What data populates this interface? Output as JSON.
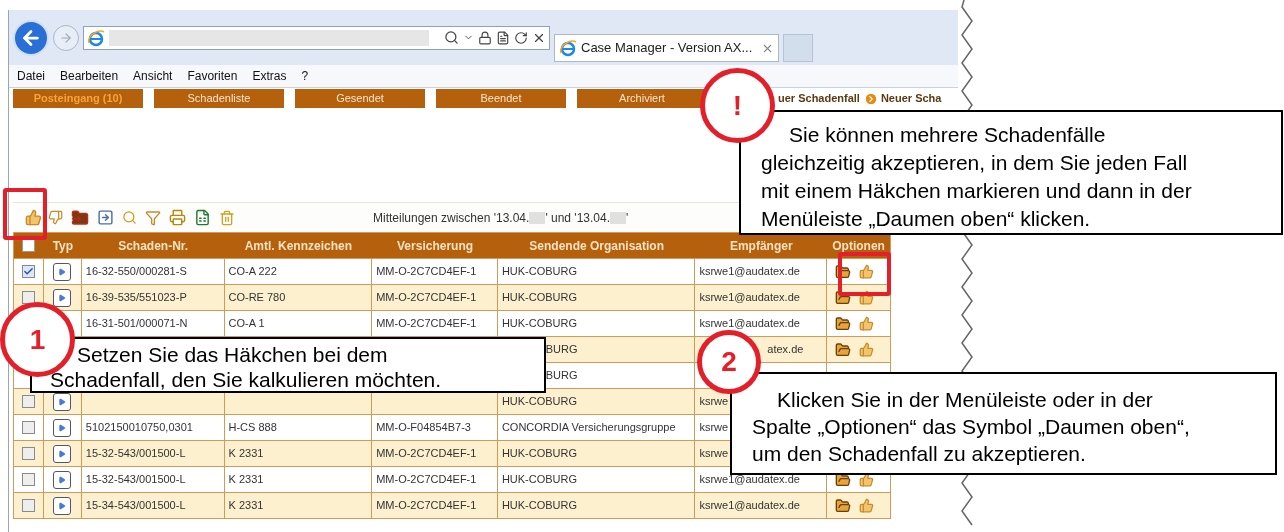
{
  "browser": {
    "tab_title": "Case Manager - Version AX...",
    "menu": [
      "Datei",
      "Bearbeiten",
      "Ansicht",
      "Favoriten",
      "Extras",
      "?"
    ]
  },
  "nav": {
    "tabs": [
      {
        "label": "Posteingang (10)",
        "selected": true
      },
      {
        "label": "Schadenliste",
        "selected": false
      },
      {
        "label": "Gesendet",
        "selected": false
      },
      {
        "label": "Beendet",
        "selected": false
      },
      {
        "label": "Archiviert",
        "selected": false
      }
    ],
    "links": [
      "uer Schadenfall",
      "Neuer Scha"
    ]
  },
  "toolbar": {
    "date_range": [
      "Mitteilungen zwischen '13.04.",
      "' und '13.04.",
      "'"
    ]
  },
  "table": {
    "select_all": {
      "checked": false
    },
    "header_labels": [
      "Typ",
      "Schaden-Nr.",
      "Amtl. Kennzeichen",
      "Versicherung",
      "Sendende Organisation",
      "Empfänger",
      "Optionen"
    ],
    "rows": [
      {
        "kind": "full",
        "checked": true,
        "cells": [
          "16-32-550/000281-S",
          "CO-A 222",
          "MM-O-2C7CD4EF-1",
          "HUK-COBURG",
          "ksrwe1@audatex.de"
        ]
      },
      {
        "kind": "full",
        "checked": false,
        "cells": [
          "16-39-535/551023-P",
          "CO-RE 780",
          "MM-O-2C7CD4EF-1",
          "HUK-COBURG",
          "ksrwe1@audatex.de"
        ]
      },
      {
        "kind": "partial",
        "cells": [
          "16-31-501/000071-N",
          "CO-A 1",
          "MM-O-2C7CD4EF-1",
          "HUK-COBURG",
          "ksrwe1@audatex.de"
        ]
      },
      {
        "kind": "covered",
        "cells": [
          null,
          null,
          null,
          "BURG",
          "atex.de"
        ]
      },
      {
        "kind": "covered_end",
        "cells": [
          null,
          null,
          null,
          "BURG",
          null
        ]
      },
      {
        "kind": "full",
        "checked": false,
        "cells": [
          null,
          null,
          null,
          "HUK-COBURG",
          "ksrwe"
        ]
      },
      {
        "kind": "full",
        "checked": false,
        "cells": [
          "5102150010750,0301",
          "H-CS 888",
          "MM-O-F04854B7-3",
          "CONCORDIA Versicherungsgruppe",
          "ksrwe"
        ]
      },
      {
        "kind": "full",
        "checked": false,
        "cells": [
          "15-32-543/001500-L",
          "K 2331",
          "MM-O-2C7CD4EF-1",
          "HUK-COBURG",
          "ksrwe"
        ]
      },
      {
        "kind": "full",
        "checked": false,
        "cells": [
          "15-32-543/001500-L",
          "K 2331",
          "MM-O-2C7CD4EF-1",
          "HUK-COBURG",
          "ksrwe1@audatex.de"
        ]
      },
      {
        "kind": "full",
        "checked": false,
        "cells": [
          "15-34-543/001500-L",
          "K 2331",
          "MM-O-2C7CD4EF-1",
          "HUK-COBURG",
          "ksrwe1@audatex.de"
        ]
      }
    ]
  },
  "callouts": [
    {
      "marker": "!",
      "text": "Sie können mehrere Schadenfälle\ngleichzeitig akzeptieren, in dem Sie jeden Fall\nmit einem Häkchen markieren und dann in der\nMenüleiste „Daumen oben“ klicken."
    },
    {
      "marker": "1",
      "text": "Setzen Sie das Häkchen bei dem\nSchadenfall, den Sie kalkulieren möchten."
    },
    {
      "marker": "2",
      "text": "Klicken Sie in der Menüleiste oder in der\nSpalte „Optionen“ das Symbol „Daumen oben“,\num den Schadenfall zu akzeptieren."
    }
  ]
}
